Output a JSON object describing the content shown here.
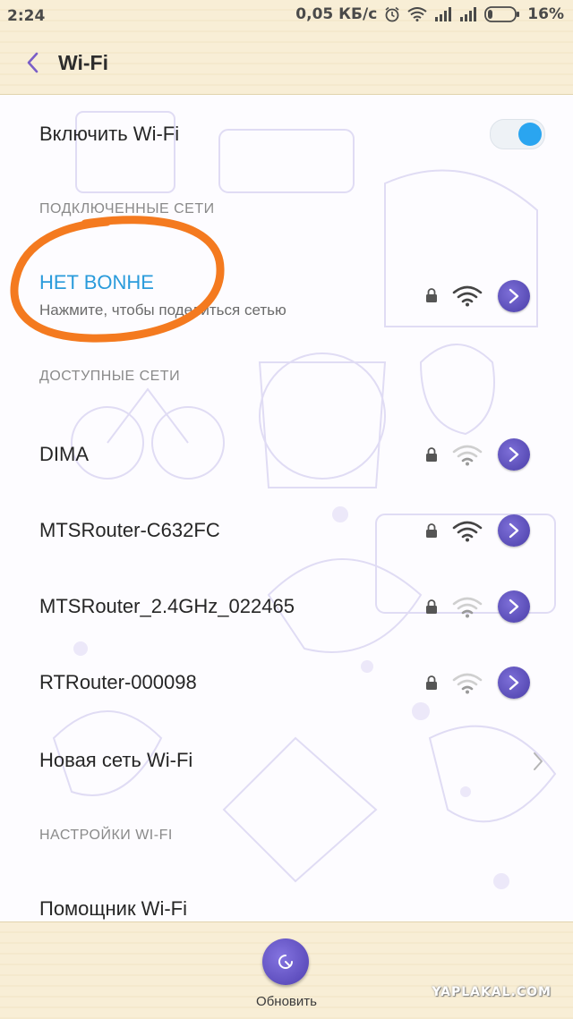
{
  "status_bar": {
    "time": "2:24",
    "speed": "0,05 КБ/с",
    "battery_percent": "16%"
  },
  "header": {
    "title": "Wi-Fi"
  },
  "wifi_toggle": {
    "label": "Включить Wi-Fi",
    "state": "on"
  },
  "sections": {
    "connected": "ПОДКЛЮЧЕННЫЕ СЕТИ",
    "available": "ДОСТУПНЫЕ СЕТИ",
    "settings": "НАСТРОЙКИ WI-FI"
  },
  "connected_network": {
    "name": "HET BONHE",
    "subtitle": "Нажмите, чтобы поделиться сетью"
  },
  "available_networks": [
    {
      "name": "DIMA",
      "secured": true,
      "signal": "weak"
    },
    {
      "name": "MTSRouter-C632FC",
      "secured": true,
      "signal": "strong"
    },
    {
      "name": "MTSRouter_2.4GHz_022465",
      "secured": true,
      "signal": "weak"
    },
    {
      "name": "RTRouter-000098",
      "secured": true,
      "signal": "weak"
    }
  ],
  "new_network_label": "Новая сеть Wi-Fi",
  "wifi_assistant_label": "Помощник Wi-Fi",
  "bottom_bar": {
    "refresh_label": "Обновить",
    "watermark": "YAPLAKAL.COM"
  },
  "colors": {
    "accent_blue": "#2aa5f0",
    "button_purple": "#5a4bc0",
    "highlight_orange": "#f47a1f"
  }
}
